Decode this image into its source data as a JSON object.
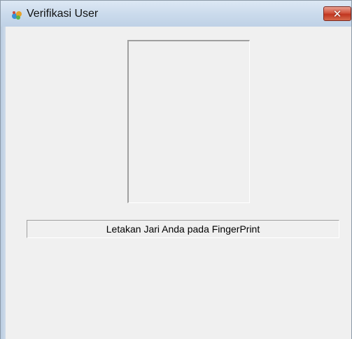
{
  "window": {
    "title": "Verifikasi User",
    "icon": "app-icon",
    "close_label": "✕"
  },
  "main": {
    "status_text": "Letakan Jari Anda pada FingerPrint"
  },
  "colors": {
    "window_background": "#f0f0f0",
    "titlebar": "#cbdbec",
    "close_button": "#c9432d"
  }
}
